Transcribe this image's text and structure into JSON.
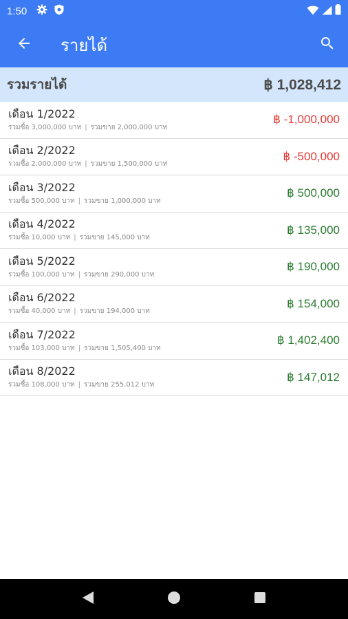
{
  "status": {
    "time": "1:50"
  },
  "app_bar": {
    "title": "รายได้"
  },
  "summary": {
    "label": "รวมรายได้",
    "value": "฿ 1,028,412"
  },
  "rows": [
    {
      "title": "เดือน 1/2022",
      "buy": "รวมซื้อ 3,000,000 บาท",
      "sell": "รวมขาย 2,000,000 บาท",
      "amount": "฿ -1,000,000",
      "kind": "neg"
    },
    {
      "title": "เดือน 2/2022",
      "buy": "รวมซื้อ 2,000,000 บาท",
      "sell": "รวมขาย 1,500,000 บาท",
      "amount": "฿ -500,000",
      "kind": "neg"
    },
    {
      "title": "เดือน 3/2022",
      "buy": "รวมซื้อ 500,000 บาท",
      "sell": "รวมขาย 1,000,000 บาท",
      "amount": "฿ 500,000",
      "kind": "pos"
    },
    {
      "title": "เดือน 4/2022",
      "buy": "รวมซื้อ 10,000 บาท",
      "sell": "รวมขาย 145,000 บาท",
      "amount": "฿ 135,000",
      "kind": "pos"
    },
    {
      "title": "เดือน 5/2022",
      "buy": "รวมซื้อ 100,000 บาท",
      "sell": "รวมขาย 290,000 บาท",
      "amount": "฿ 190,000",
      "kind": "pos"
    },
    {
      "title": "เดือน 6/2022",
      "buy": "รวมซื้อ 40,000 บาท",
      "sell": "รวมขาย 194,000 บาท",
      "amount": "฿ 154,000",
      "kind": "pos"
    },
    {
      "title": "เดือน 7/2022",
      "buy": "รวมซื้อ 103,000 บาท",
      "sell": "รวมขาย 1,505,400 บาท",
      "amount": "฿ 1,402,400",
      "kind": "pos"
    },
    {
      "title": "เดือน 8/2022",
      "buy": "รวมซื้อ 108,000 บาท",
      "sell": "รวมขาย 255,012 บาท",
      "amount": "฿ 147,012",
      "kind": "pos"
    }
  ],
  "colors": {
    "primary": "#3d7bf5",
    "summary_bg": "#d3e6fb",
    "negative": "#e53935",
    "positive": "#2e7d32"
  },
  "icons": {
    "status": [
      "gear-icon",
      "shield-icon",
      "wifi-icon",
      "signal-icon",
      "battery-icon"
    ],
    "app_bar": [
      "back-arrow-icon",
      "search-icon"
    ],
    "nav": [
      "nav-back-icon",
      "nav-home-icon",
      "nav-recents-icon"
    ]
  }
}
